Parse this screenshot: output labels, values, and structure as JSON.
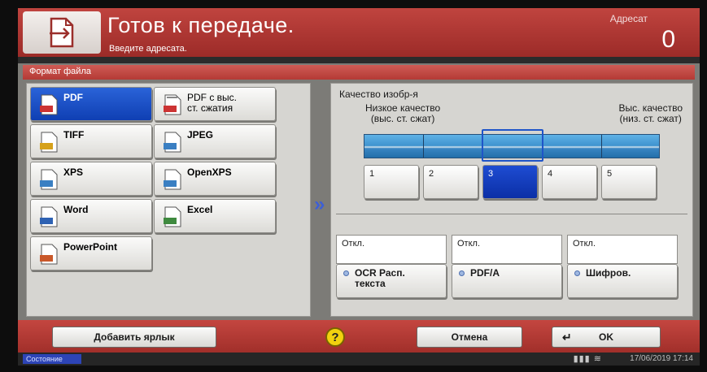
{
  "header": {
    "title": "Готов к передаче.",
    "subtitle": "Введите адресата.",
    "address_label": "Адресат",
    "address_count": "0",
    "icon": "send-document-icon"
  },
  "format_panel": {
    "title": "Формат файла",
    "selected": "PDF",
    "items": [
      {
        "label": "PDF",
        "icon": "pdf-file-icon"
      },
      {
        "label": "PDF с выс.",
        "label2": "ст. сжатия",
        "icon": "pdf-compressed-icon"
      },
      {
        "label": "TIFF",
        "icon": "tiff-file-icon"
      },
      {
        "label": "JPEG",
        "icon": "jpeg-file-icon"
      },
      {
        "label": "XPS",
        "icon": "xps-file-icon"
      },
      {
        "label": "OpenXPS",
        "icon": "openxps-file-icon"
      },
      {
        "label": "Word",
        "icon": "word-file-icon"
      },
      {
        "label": "Excel",
        "icon": "excel-file-icon"
      },
      {
        "label": "PowerPoint",
        "icon": "powerpoint-file-icon"
      }
    ]
  },
  "quality": {
    "title": "Качество изобр-я",
    "low_line1": "Низкое качество",
    "low_line2": "(выс. ст. сжат)",
    "high_line1": "Выс. качество",
    "high_line2": "(низ. ст. сжат)",
    "levels": [
      "1",
      "2",
      "3",
      "4",
      "5"
    ],
    "selected_level": "3"
  },
  "options": [
    {
      "state": "Откл.",
      "label": "OCR Расп.",
      "label2": "текста"
    },
    {
      "state": "Откл.",
      "label": "PDF/A",
      "label2": ""
    },
    {
      "state": "Откл.",
      "label": "Шифров.",
      "label2": ""
    }
  ],
  "bottom": {
    "add_shortcut": "Добавить ярлык",
    "help": "?",
    "cancel": "Отмена",
    "ok": "OK"
  },
  "status": {
    "label": "Состояние",
    "datetime": "17/06/2019  17:14"
  },
  "colors": {
    "header_red": "#b13834",
    "selected_blue": "#1540c0",
    "help_yellow": "#f1d20f"
  }
}
